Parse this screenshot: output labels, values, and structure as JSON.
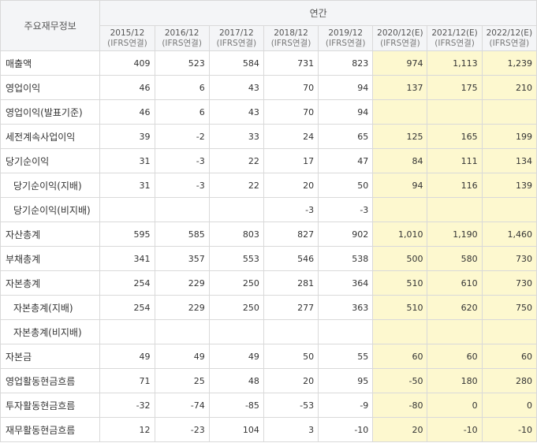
{
  "header": {
    "title": "주요재무정보",
    "group": "연간",
    "years": [
      {
        "label": "2015/12",
        "sub": "(IFRS연결)",
        "estimate": false
      },
      {
        "label": "2016/12",
        "sub": "(IFRS연결)",
        "estimate": false
      },
      {
        "label": "2017/12",
        "sub": "(IFRS연결)",
        "estimate": false
      },
      {
        "label": "2018/12",
        "sub": "(IFRS연결)",
        "estimate": false
      },
      {
        "label": "2019/12",
        "sub": "(IFRS연결)",
        "estimate": false
      },
      {
        "label": "2020/12(E)",
        "sub": "(IFRS연결)",
        "estimate": true
      },
      {
        "label": "2021/12(E)",
        "sub": "(IFRS연결)",
        "estimate": true
      },
      {
        "label": "2022/12(E)",
        "sub": "(IFRS연결)",
        "estimate": true
      }
    ]
  },
  "rows": [
    {
      "label": "매출액",
      "indent": false,
      "values": [
        "409",
        "523",
        "584",
        "731",
        "823",
        "974",
        "1,113",
        "1,239"
      ]
    },
    {
      "label": "영업이익",
      "indent": false,
      "values": [
        "46",
        "6",
        "43",
        "70",
        "94",
        "137",
        "175",
        "210"
      ]
    },
    {
      "label": "영업이익(발표기준)",
      "indent": false,
      "values": [
        "46",
        "6",
        "43",
        "70",
        "94",
        "",
        "",
        ""
      ]
    },
    {
      "label": "세전계속사업이익",
      "indent": false,
      "values": [
        "39",
        "-2",
        "33",
        "24",
        "65",
        "125",
        "165",
        "199"
      ]
    },
    {
      "label": "당기순이익",
      "indent": false,
      "values": [
        "31",
        "-3",
        "22",
        "17",
        "47",
        "84",
        "111",
        "134"
      ]
    },
    {
      "label": "당기순이익(지배)",
      "indent": true,
      "values": [
        "31",
        "-3",
        "22",
        "20",
        "50",
        "94",
        "116",
        "139"
      ]
    },
    {
      "label": "당기순이익(비지배)",
      "indent": true,
      "values": [
        "",
        "",
        "",
        "-3",
        "-3",
        "",
        "",
        ""
      ]
    },
    {
      "label": "자산총계",
      "indent": false,
      "values": [
        "595",
        "585",
        "803",
        "827",
        "902",
        "1,010",
        "1,190",
        "1,460"
      ]
    },
    {
      "label": "부채총계",
      "indent": false,
      "values": [
        "341",
        "357",
        "553",
        "546",
        "538",
        "500",
        "580",
        "730"
      ]
    },
    {
      "label": "자본총계",
      "indent": false,
      "values": [
        "254",
        "229",
        "250",
        "281",
        "364",
        "510",
        "610",
        "730"
      ]
    },
    {
      "label": "자본총계(지배)",
      "indent": true,
      "values": [
        "254",
        "229",
        "250",
        "277",
        "363",
        "510",
        "620",
        "750"
      ]
    },
    {
      "label": "자본총계(비지배)",
      "indent": true,
      "values": [
        "",
        "",
        "",
        "",
        "",
        "",
        "",
        ""
      ]
    },
    {
      "label": "자본금",
      "indent": false,
      "values": [
        "49",
        "49",
        "49",
        "50",
        "55",
        "60",
        "60",
        "60"
      ]
    },
    {
      "label": "영업활동현금흐름",
      "indent": false,
      "values": [
        "71",
        "25",
        "48",
        "20",
        "95",
        "-50",
        "180",
        "280"
      ]
    },
    {
      "label": "투자활동현금흐름",
      "indent": false,
      "values": [
        "-32",
        "-74",
        "-85",
        "-53",
        "-9",
        "-80",
        "0",
        "0"
      ]
    },
    {
      "label": "재무활동현금흐름",
      "indent": false,
      "values": [
        "12",
        "-23",
        "104",
        "3",
        "-10",
        "20",
        "-10",
        "-10"
      ]
    }
  ],
  "colors": {
    "estimate_bg": "#fdf8cf",
    "negative": "#e0393e",
    "header_bg": "#f4f5f7",
    "border": "#d9d9d9"
  }
}
